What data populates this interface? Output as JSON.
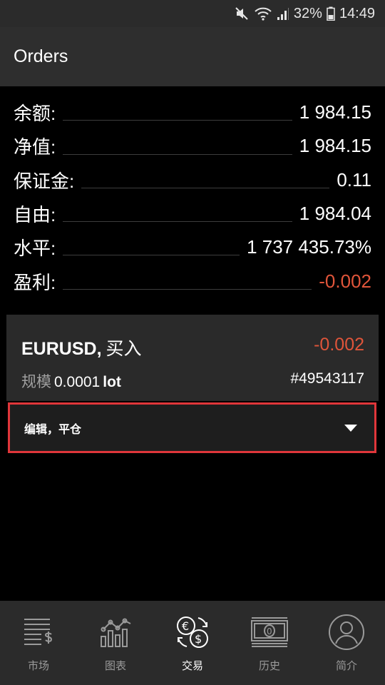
{
  "status_bar": {
    "battery": "32%",
    "time": "14:49"
  },
  "appbar": {
    "title": "Orders"
  },
  "summary": [
    {
      "label": "余额:",
      "value": "1 984.15",
      "negative": false
    },
    {
      "label": "净值:",
      "value": "1 984.15",
      "negative": false
    },
    {
      "label": "保证金:",
      "value": "0.11",
      "negative": false
    },
    {
      "label": "自由:",
      "value": "1 984.04",
      "negative": false
    },
    {
      "label": "水平:",
      "value": "1 737 435.73%",
      "negative": false
    },
    {
      "label": "盈利:",
      "value": "-0.002",
      "negative": true
    }
  ],
  "order": {
    "symbol": "EURUSD,",
    "side": "买入",
    "profit": "-0.002",
    "volume_label": "规模",
    "volume": "0.0001",
    "volume_unit": "lot",
    "ticket": "#49543117"
  },
  "action": {
    "label": "编辑，平仓"
  },
  "tabs": [
    {
      "label": "市场",
      "icon": "market-list-dollar-icon",
      "active": false
    },
    {
      "label": "图表",
      "icon": "chart-icon",
      "active": false
    },
    {
      "label": "交易",
      "icon": "currency-exchange-icon",
      "active": true
    },
    {
      "label": "历史",
      "icon": "banknote-icon",
      "active": false
    },
    {
      "label": "简介",
      "icon": "profile-icon",
      "active": false
    }
  ],
  "colors": {
    "negative": "#e0553a",
    "highlight_border": "#e0363a",
    "bar_bg": "#2b2b2b"
  }
}
